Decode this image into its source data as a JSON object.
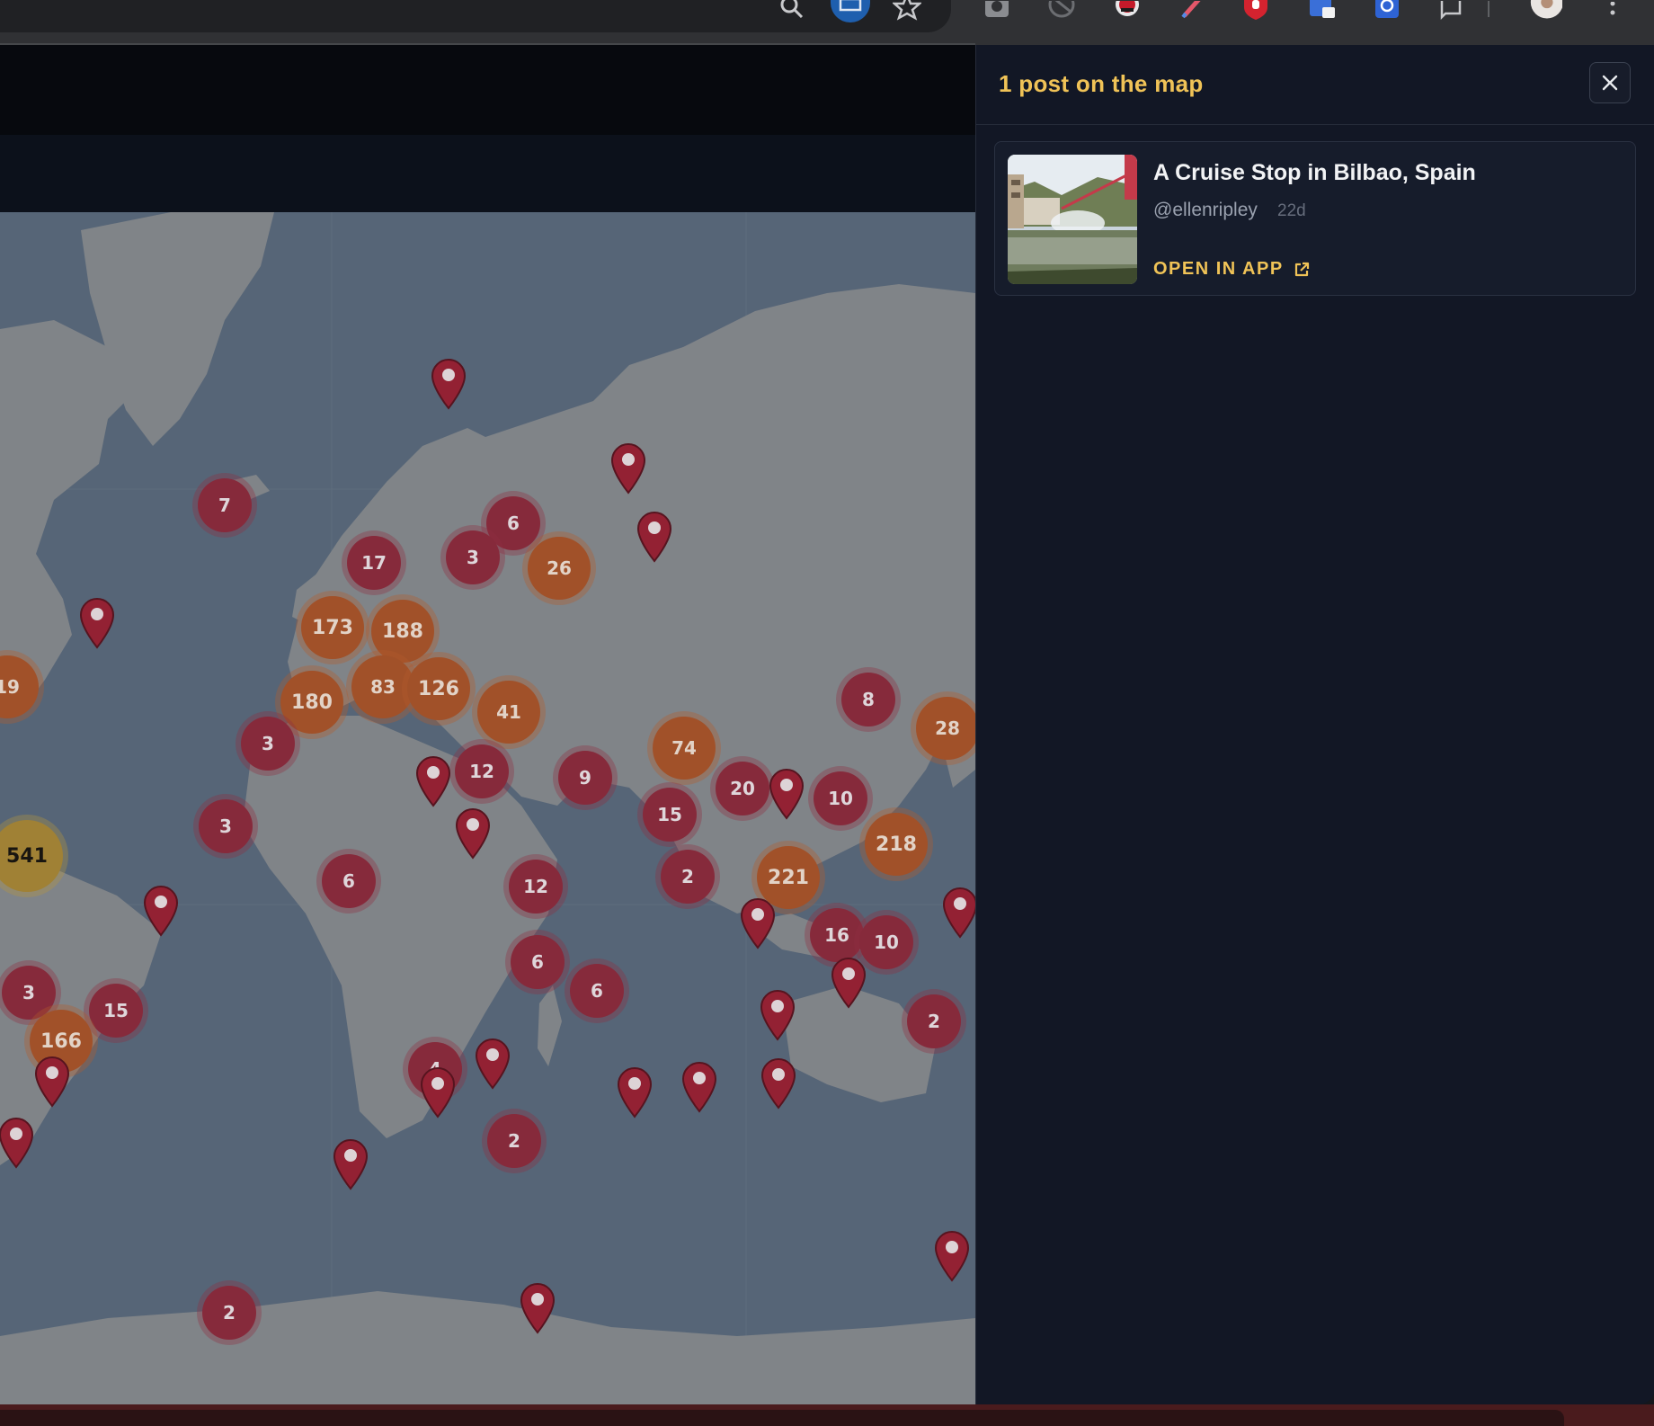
{
  "browser": {
    "toolbar_icons": [
      "search-icon",
      "screen-share-icon",
      "bookmark-star-icon",
      "camera-extension-icon",
      "blocked-extension-icon",
      "key-extension-icon",
      "pen-extension-icon",
      "shield-extension-icon",
      "lock-extension-icon",
      "gear-extension-icon",
      "puzzle-extension-icon",
      "profile-avatar",
      "more-menu-icon"
    ]
  },
  "colors": {
    "accent": "#f0c357",
    "panel_bg": "#121725",
    "cluster_red": "#8c2c3d",
    "cluster_orange": "#a8552a",
    "cluster_gold": "#a78737",
    "pin": "#9a2335",
    "ocean": "#5a6a7b",
    "land": "#868a8d"
  },
  "map": {
    "clusters": [
      {
        "label": "7",
        "tier": "red"
      },
      {
        "label": "17",
        "tier": "red"
      },
      {
        "label": "6",
        "tier": "red"
      },
      {
        "label": "3",
        "tier": "red"
      },
      {
        "label": "26",
        "tier": "orange"
      },
      {
        "label": "173",
        "tier": "orange"
      },
      {
        "label": "188",
        "tier": "orange"
      },
      {
        "label": "83",
        "tier": "orange"
      },
      {
        "label": "126",
        "tier": "orange"
      },
      {
        "label": "180",
        "tier": "orange"
      },
      {
        "label": "41",
        "tier": "orange"
      },
      {
        "label": "19",
        "tier": "orange"
      },
      {
        "label": "3",
        "tier": "red"
      },
      {
        "label": "12",
        "tier": "red"
      },
      {
        "label": "9",
        "tier": "red"
      },
      {
        "label": "74",
        "tier": "orange"
      },
      {
        "label": "20",
        "tier": "red"
      },
      {
        "label": "15",
        "tier": "red"
      },
      {
        "label": "8",
        "tier": "red"
      },
      {
        "label": "28",
        "tier": "orange"
      },
      {
        "label": "10",
        "tier": "red"
      },
      {
        "label": "218",
        "tier": "orange"
      },
      {
        "label": "221",
        "tier": "orange"
      },
      {
        "label": "2",
        "tier": "red"
      },
      {
        "label": "541",
        "tier": "gold"
      },
      {
        "label": "3",
        "tier": "red"
      },
      {
        "label": "6",
        "tier": "red"
      },
      {
        "label": "12",
        "tier": "red"
      },
      {
        "label": "16",
        "tier": "red"
      },
      {
        "label": "10",
        "tier": "red"
      },
      {
        "label": "3",
        "tier": "red"
      },
      {
        "label": "15",
        "tier": "red"
      },
      {
        "label": "166",
        "tier": "orange"
      },
      {
        "label": "6",
        "tier": "red"
      },
      {
        "label": "6",
        "tier": "red"
      },
      {
        "label": "2",
        "tier": "red"
      },
      {
        "label": "4",
        "tier": "red"
      },
      {
        "label": "2",
        "tier": "red"
      },
      {
        "label": "2",
        "tier": "red"
      }
    ],
    "pin_count": 22
  },
  "panel": {
    "title": "1 post on the map",
    "close_icon": "close-icon",
    "post": {
      "title": "A Cruise Stop in Bilbao, Spain",
      "author": "@ellenripley",
      "age": "22d",
      "open_label": "OPEN IN APP",
      "open_icon": "external-link-icon"
    }
  }
}
